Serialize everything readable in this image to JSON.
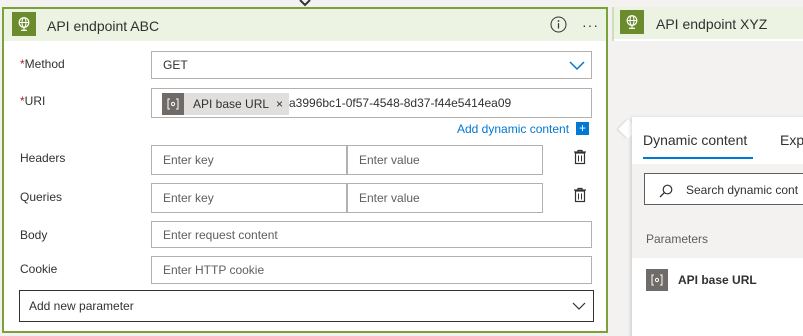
{
  "card_abc": {
    "title": "API endpoint ABC",
    "more_label": "···",
    "method": {
      "label": "Method",
      "required_mark": "*",
      "value": "GET"
    },
    "uri": {
      "label": "URI",
      "required_mark": "*",
      "token_label": "API base URL",
      "token_remove": "×",
      "value_text": "a3996bc1-0f57-4548-8d37-f44e5414ea09"
    },
    "add_dynamic_content": "Add dynamic content",
    "add_dynamic_icon": "+",
    "headers": {
      "label": "Headers",
      "key_placeholder": "Enter key",
      "value_placeholder": "Enter value"
    },
    "queries": {
      "label": "Queries",
      "key_placeholder": "Enter key",
      "value_placeholder": "Enter value"
    },
    "body": {
      "label": "Body",
      "placeholder": "Enter request content"
    },
    "cookie": {
      "label": "Cookie",
      "placeholder": "Enter HTTP cookie"
    },
    "add_new_parameter": "Add new parameter"
  },
  "card_xyz": {
    "title": "API endpoint XYZ"
  },
  "dynamic_panel": {
    "tab_dynamic": "Dynamic content",
    "tab_expression": "Expr",
    "search_placeholder": "Search dynamic cont",
    "section_label": "Parameters",
    "items": [
      {
        "label": "API base URL"
      }
    ]
  },
  "colors": {
    "accent_blue": "#0078d4",
    "card_border": "#7aa13a",
    "header_bg": "#edf3e2",
    "connector_icon": "#6c8b2c",
    "required": "#a4262c"
  },
  "icons": {
    "connector": "globe-icon",
    "info": "info-icon",
    "trash": "trash-icon",
    "chevron": "chevron-down-icon",
    "search": "search-icon",
    "parameter": "parameter-icon"
  }
}
